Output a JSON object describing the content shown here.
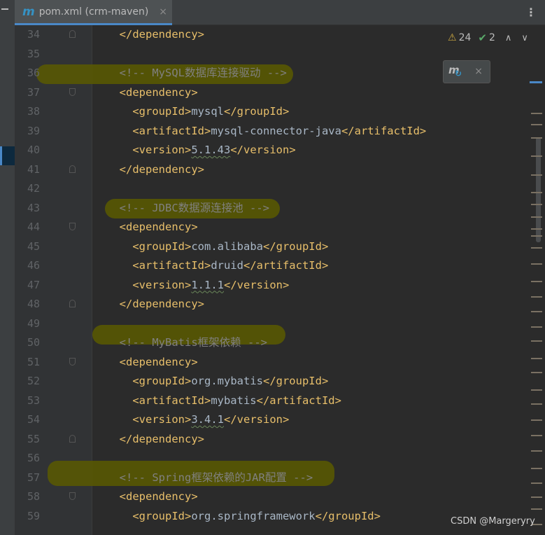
{
  "tab": {
    "icon": "maven-m-icon",
    "title": "pom.xml (crm-maven)",
    "close": "×"
  },
  "menu_glyph": "⋮",
  "inspections": {
    "warnings": "24",
    "ok": "2",
    "warn_glyph": "⚠",
    "ok_glyph": "✔",
    "up": "∧",
    "down": "∨"
  },
  "maven_popup": {
    "m": "m",
    "reload": "↻",
    "close": "×"
  },
  "lines": [
    {
      "n": "34",
      "indent": "",
      "kind": "close",
      "text": "</dependency>"
    },
    {
      "n": "35",
      "kind": "blank"
    },
    {
      "n": "36",
      "indent": "",
      "kind": "comment",
      "text": "<!-- MySQL数据库连接驱动 -->"
    },
    {
      "n": "37",
      "indent": "",
      "kind": "open",
      "text": "<dependency>"
    },
    {
      "n": "38",
      "indent": "  ",
      "kind": "element",
      "open": "<groupId>",
      "value": "mysql",
      "close": "</groupId>"
    },
    {
      "n": "39",
      "indent": "  ",
      "kind": "element",
      "open": "<artifactId>",
      "value": "mysql-connector-java",
      "close": "</artifactId>"
    },
    {
      "n": "40",
      "indent": "  ",
      "kind": "version",
      "open": "<version>",
      "value": "5.1.43",
      "close": "</version>"
    },
    {
      "n": "41",
      "indent": "",
      "kind": "close",
      "text": "</dependency>"
    },
    {
      "n": "42",
      "kind": "blank"
    },
    {
      "n": "43",
      "indent": "",
      "kind": "comment",
      "text": "<!-- JDBC数据源连接池 -->"
    },
    {
      "n": "44",
      "indent": "",
      "kind": "open",
      "text": "<dependency>"
    },
    {
      "n": "45",
      "indent": "  ",
      "kind": "element",
      "open": "<groupId>",
      "value": "com.alibaba",
      "close": "</groupId>"
    },
    {
      "n": "46",
      "indent": "  ",
      "kind": "element",
      "open": "<artifactId>",
      "value": "druid",
      "close": "</artifactId>"
    },
    {
      "n": "47",
      "indent": "  ",
      "kind": "version",
      "open": "<version>",
      "value": "1.1.1",
      "close": "</version>"
    },
    {
      "n": "48",
      "indent": "",
      "kind": "close",
      "text": "</dependency>"
    },
    {
      "n": "49",
      "kind": "blank"
    },
    {
      "n": "50",
      "indent": "",
      "kind": "comment",
      "text": "<!-- MyBatis框架依赖 -->"
    },
    {
      "n": "51",
      "indent": "",
      "kind": "open",
      "text": "<dependency>"
    },
    {
      "n": "52",
      "indent": "  ",
      "kind": "element",
      "open": "<groupId>",
      "value": "org.mybatis",
      "close": "</groupId>"
    },
    {
      "n": "53",
      "indent": "  ",
      "kind": "element",
      "open": "<artifactId>",
      "value": "mybatis",
      "close": "</artifactId>"
    },
    {
      "n": "54",
      "indent": "  ",
      "kind": "version",
      "open": "<version>",
      "value": "3.4.1",
      "close": "</version>"
    },
    {
      "n": "55",
      "indent": "",
      "kind": "close",
      "text": "</dependency>"
    },
    {
      "n": "56",
      "kind": "blank"
    },
    {
      "n": "57",
      "indent": "",
      "kind": "comment",
      "text": "<!-- Spring框架依赖的JAR配置 -->"
    },
    {
      "n": "58",
      "indent": "",
      "kind": "open",
      "text": "<dependency>"
    },
    {
      "n": "59",
      "indent": "  ",
      "kind": "element",
      "open": "<groupId>",
      "value": "org.springframework",
      "close": "</groupId>"
    }
  ],
  "watermark": "CSDN @Margeryry"
}
